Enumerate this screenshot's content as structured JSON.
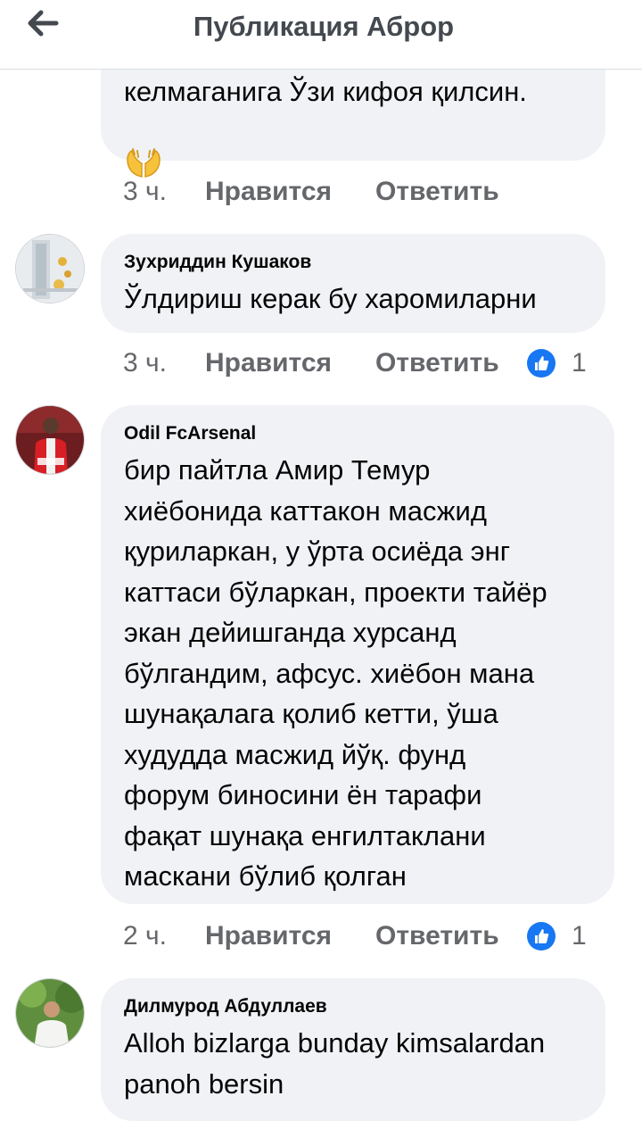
{
  "header": {
    "title": "Публикация Аброр",
    "back_icon": "arrow-left-icon"
  },
  "colors": {
    "bubble": "#f0f2f5",
    "action_text": "#65676b",
    "like_blue": "#1877f2",
    "title_text": "#444950"
  },
  "actions": {
    "like": "Нравится",
    "reply": "Ответить"
  },
  "comments": [
    {
      "author": "",
      "lines": [
        "келмаганига Ўзи кифоя қилсин."
      ],
      "emoji": "praying-hands-icon",
      "time": "3 ч.",
      "reactions": ""
    },
    {
      "author": "Зухриддин Кушаков",
      "lines": [
        "Ўлдириш керак бу харомиларни"
      ],
      "time": "3 ч.",
      "reactions": "1"
    },
    {
      "author": "Odil FcArsenal",
      "lines": [
        "бир пайтла Амир Темур",
        "хиёбонида каттакон масжид",
        "қуриларкан, у ўрта осиёда энг",
        "каттаси бўларкан, проекти тайёр",
        "экан дейишганда хурсанд",
        "бўлгандим, афсус. хиёбон мана",
        "шунақалага қолиб кетти, ўша",
        "худудда масжид йўқ. фунд",
        "форум биносини ён тарафи",
        "фақат шунақа енгилтаклани",
        "маскани бўлиб қолган"
      ],
      "time": "2 ч.",
      "reactions": "1"
    },
    {
      "author": "Дилмурод Абдуллаев",
      "lines": [
        "Alloh bizlarga bunday kimsalardan",
        "panoh bersin"
      ]
    }
  ]
}
